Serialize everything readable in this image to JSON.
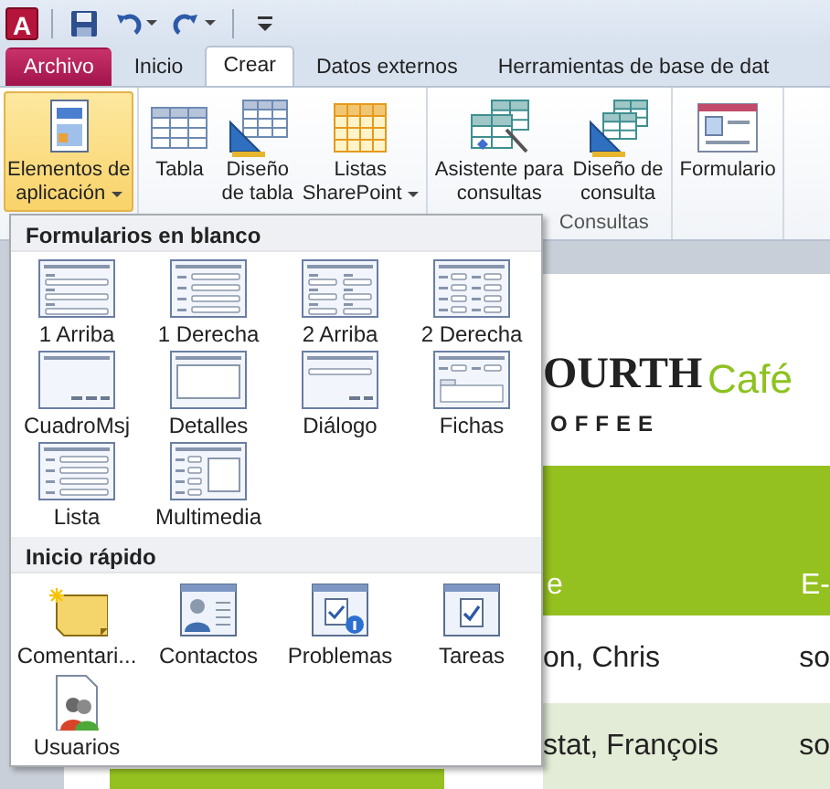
{
  "quick_access": {
    "app_icon": "A",
    "buttons": [
      {
        "kind": "save",
        "dropdown": false
      },
      {
        "kind": "undo",
        "dropdown": true
      },
      {
        "kind": "redo",
        "dropdown": true
      },
      {
        "kind": "customize",
        "dropdown": false
      }
    ]
  },
  "tabs": [
    {
      "label": "Archivo",
      "kind": "file",
      "selected": false
    },
    {
      "label": "Inicio",
      "kind": "tab",
      "selected": false
    },
    {
      "label": "Crear",
      "kind": "tab",
      "selected": true
    },
    {
      "label": "Datos externos",
      "kind": "tab",
      "selected": false
    },
    {
      "label": "Herramientas de base de dat",
      "kind": "tab",
      "selected": false
    }
  ],
  "ribbon": {
    "groups": [
      {
        "buttons": [
          {
            "label": "Elementos de\naplicación",
            "dropdown": true,
            "expanded": true
          }
        ]
      },
      {
        "buttons": [
          {
            "label": "Tabla",
            "dropdown": false,
            "expanded": false
          },
          {
            "label": "Diseño\nde tabla",
            "dropdown": false,
            "expanded": false
          },
          {
            "label": "Listas\nSharePoint",
            "dropdown": true,
            "expanded": false
          }
        ]
      },
      {
        "label": "Consultas",
        "buttons": [
          {
            "label": "Asistente para\nconsultas",
            "dropdown": false,
            "expanded": false
          },
          {
            "label": "Diseño de\nconsulta",
            "dropdown": false,
            "expanded": false
          }
        ]
      },
      {
        "buttons": [
          {
            "label": "Formulario",
            "dropdown": false,
            "expanded": false
          }
        ]
      }
    ]
  },
  "menu": {
    "sections": [
      {
        "title": "Formularios en blanco",
        "items": [
          {
            "label": "1 Arriba",
            "kind": "one-up"
          },
          {
            "label": "1 Derecha",
            "kind": "one-right"
          },
          {
            "label": "2 Arriba",
            "kind": "two-up"
          },
          {
            "label": "2 Derecha",
            "kind": "two-right"
          },
          {
            "label": "CuadroMsj",
            "kind": "msgbox"
          },
          {
            "label": "Detalles",
            "kind": "details"
          },
          {
            "label": "Diálogo",
            "kind": "dialog"
          },
          {
            "label": "Fichas",
            "kind": "tabs"
          },
          {
            "label": "Lista",
            "kind": "list"
          },
          {
            "label": "Multimedia",
            "kind": "multimedia"
          }
        ]
      },
      {
        "title": "Inicio rápido",
        "items": [
          {
            "label": "Comentari...",
            "kind": "note"
          },
          {
            "label": "Contactos",
            "kind": "contacts"
          },
          {
            "label": "Problemas",
            "kind": "issues"
          },
          {
            "label": "Tareas",
            "kind": "tasks"
          },
          {
            "label": "Usuarios",
            "kind": "users"
          }
        ]
      }
    ]
  },
  "form": {
    "logo_text": "OURTH",
    "logo_accent": "Café",
    "logo_subtext": "OFFEE",
    "header": [
      "e",
      "E-"
    ],
    "rows": [
      [
        "on, Chris",
        "so"
      ],
      [
        "stat, François",
        "so"
      ]
    ]
  }
}
